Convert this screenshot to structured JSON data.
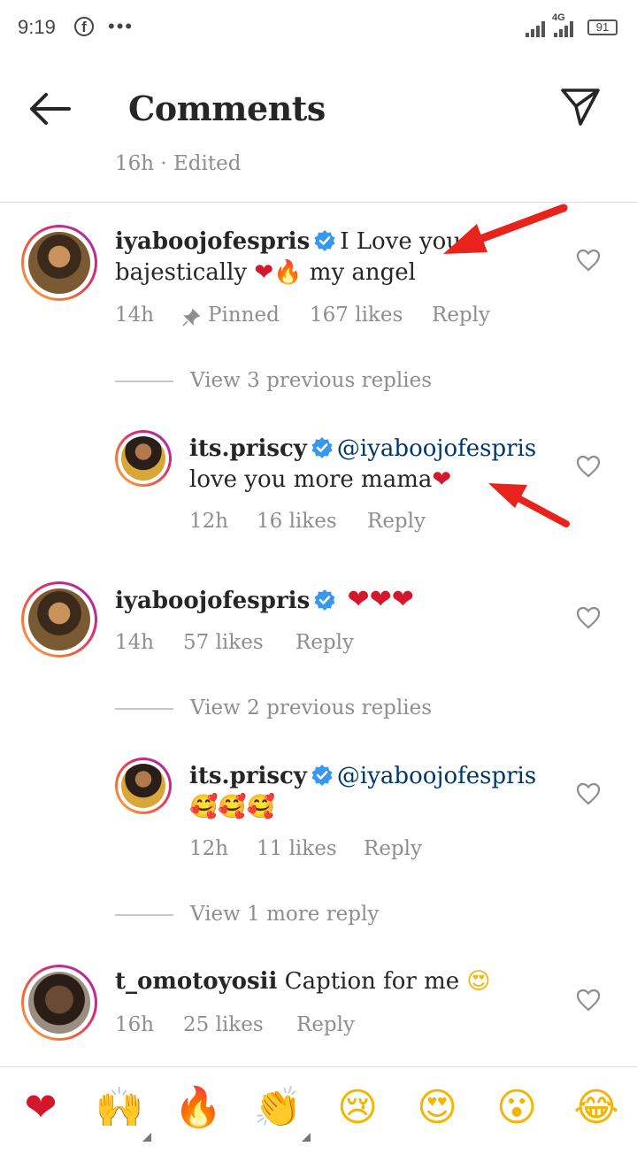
{
  "status": {
    "time": "9:19",
    "network": "4G",
    "battery": "91"
  },
  "header": {
    "title": "Comments"
  },
  "caption_meta": "16h · Edited",
  "comments": [
    {
      "username": "iyaboojofespris",
      "text_line1": "I Love you",
      "text_line2": "bajestically",
      "text_line2_tail": "my angel",
      "time": "14h",
      "pinned": "Pinned",
      "likes": "167 likes",
      "reply": "Reply",
      "view_replies": "View 3 previous replies"
    },
    {
      "username": "its.priscy",
      "mention": "@iyaboojofespris",
      "text": "love you more mama",
      "time": "12h",
      "likes": "16 likes",
      "reply": "Reply"
    },
    {
      "username": "iyaboojofespris",
      "text": "❤❤❤",
      "time": "14h",
      "likes": "57 likes",
      "reply": "Reply",
      "view_replies": "View 2 previous replies"
    },
    {
      "username": "its.priscy",
      "mention": "@iyaboojofespris",
      "text": "🥰🥰🥰",
      "time": "12h",
      "likes": "11 likes",
      "reply": "Reply",
      "view_replies": "View 1 more reply"
    },
    {
      "username": "t_omotoyosii",
      "text": "Caption for me",
      "time": "16h",
      "likes": "25 likes",
      "reply": "Reply"
    }
  ],
  "reactions": [
    "❤",
    "🙌",
    "🔥",
    "👏",
    "😢",
    "😍",
    "😮",
    "😂"
  ],
  "colors": {
    "accent_arrow": "#e8231c",
    "verified": "#3897f0",
    "mention": "#00376b",
    "muted": "#8e8e8e"
  }
}
